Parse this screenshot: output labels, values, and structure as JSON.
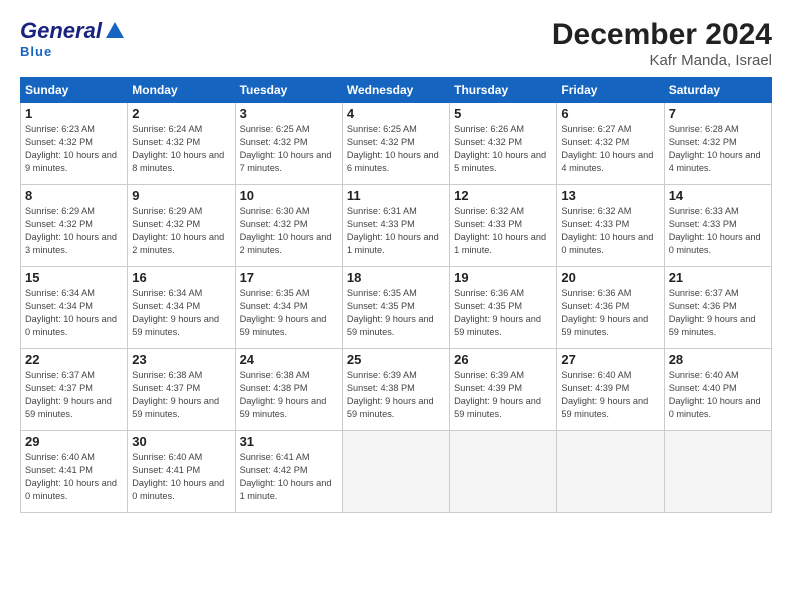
{
  "header": {
    "logo_general": "General",
    "logo_blue": "Blue",
    "month_title": "December 2024",
    "location": "Kafr Manda, Israel"
  },
  "weekdays": [
    "Sunday",
    "Monday",
    "Tuesday",
    "Wednesday",
    "Thursday",
    "Friday",
    "Saturday"
  ],
  "weeks": [
    [
      {
        "day": "1",
        "sunrise": "Sunrise: 6:23 AM",
        "sunset": "Sunset: 4:32 PM",
        "daylight": "Daylight: 10 hours and 9 minutes."
      },
      {
        "day": "2",
        "sunrise": "Sunrise: 6:24 AM",
        "sunset": "Sunset: 4:32 PM",
        "daylight": "Daylight: 10 hours and 8 minutes."
      },
      {
        "day": "3",
        "sunrise": "Sunrise: 6:25 AM",
        "sunset": "Sunset: 4:32 PM",
        "daylight": "Daylight: 10 hours and 7 minutes."
      },
      {
        "day": "4",
        "sunrise": "Sunrise: 6:25 AM",
        "sunset": "Sunset: 4:32 PM",
        "daylight": "Daylight: 10 hours and 6 minutes."
      },
      {
        "day": "5",
        "sunrise": "Sunrise: 6:26 AM",
        "sunset": "Sunset: 4:32 PM",
        "daylight": "Daylight: 10 hours and 5 minutes."
      },
      {
        "day": "6",
        "sunrise": "Sunrise: 6:27 AM",
        "sunset": "Sunset: 4:32 PM",
        "daylight": "Daylight: 10 hours and 4 minutes."
      },
      {
        "day": "7",
        "sunrise": "Sunrise: 6:28 AM",
        "sunset": "Sunset: 4:32 PM",
        "daylight": "Daylight: 10 hours and 4 minutes."
      }
    ],
    [
      {
        "day": "8",
        "sunrise": "Sunrise: 6:29 AM",
        "sunset": "Sunset: 4:32 PM",
        "daylight": "Daylight: 10 hours and 3 minutes."
      },
      {
        "day": "9",
        "sunrise": "Sunrise: 6:29 AM",
        "sunset": "Sunset: 4:32 PM",
        "daylight": "Daylight: 10 hours and 2 minutes."
      },
      {
        "day": "10",
        "sunrise": "Sunrise: 6:30 AM",
        "sunset": "Sunset: 4:32 PM",
        "daylight": "Daylight: 10 hours and 2 minutes."
      },
      {
        "day": "11",
        "sunrise": "Sunrise: 6:31 AM",
        "sunset": "Sunset: 4:33 PM",
        "daylight": "Daylight: 10 hours and 1 minute."
      },
      {
        "day": "12",
        "sunrise": "Sunrise: 6:32 AM",
        "sunset": "Sunset: 4:33 PM",
        "daylight": "Daylight: 10 hours and 1 minute."
      },
      {
        "day": "13",
        "sunrise": "Sunrise: 6:32 AM",
        "sunset": "Sunset: 4:33 PM",
        "daylight": "Daylight: 10 hours and 0 minutes."
      },
      {
        "day": "14",
        "sunrise": "Sunrise: 6:33 AM",
        "sunset": "Sunset: 4:33 PM",
        "daylight": "Daylight: 10 hours and 0 minutes."
      }
    ],
    [
      {
        "day": "15",
        "sunrise": "Sunrise: 6:34 AM",
        "sunset": "Sunset: 4:34 PM",
        "daylight": "Daylight: 10 hours and 0 minutes."
      },
      {
        "day": "16",
        "sunrise": "Sunrise: 6:34 AM",
        "sunset": "Sunset: 4:34 PM",
        "daylight": "Daylight: 9 hours and 59 minutes."
      },
      {
        "day": "17",
        "sunrise": "Sunrise: 6:35 AM",
        "sunset": "Sunset: 4:34 PM",
        "daylight": "Daylight: 9 hours and 59 minutes."
      },
      {
        "day": "18",
        "sunrise": "Sunrise: 6:35 AM",
        "sunset": "Sunset: 4:35 PM",
        "daylight": "Daylight: 9 hours and 59 minutes."
      },
      {
        "day": "19",
        "sunrise": "Sunrise: 6:36 AM",
        "sunset": "Sunset: 4:35 PM",
        "daylight": "Daylight: 9 hours and 59 minutes."
      },
      {
        "day": "20",
        "sunrise": "Sunrise: 6:36 AM",
        "sunset": "Sunset: 4:36 PM",
        "daylight": "Daylight: 9 hours and 59 minutes."
      },
      {
        "day": "21",
        "sunrise": "Sunrise: 6:37 AM",
        "sunset": "Sunset: 4:36 PM",
        "daylight": "Daylight: 9 hours and 59 minutes."
      }
    ],
    [
      {
        "day": "22",
        "sunrise": "Sunrise: 6:37 AM",
        "sunset": "Sunset: 4:37 PM",
        "daylight": "Daylight: 9 hours and 59 minutes."
      },
      {
        "day": "23",
        "sunrise": "Sunrise: 6:38 AM",
        "sunset": "Sunset: 4:37 PM",
        "daylight": "Daylight: 9 hours and 59 minutes."
      },
      {
        "day": "24",
        "sunrise": "Sunrise: 6:38 AM",
        "sunset": "Sunset: 4:38 PM",
        "daylight": "Daylight: 9 hours and 59 minutes."
      },
      {
        "day": "25",
        "sunrise": "Sunrise: 6:39 AM",
        "sunset": "Sunset: 4:38 PM",
        "daylight": "Daylight: 9 hours and 59 minutes."
      },
      {
        "day": "26",
        "sunrise": "Sunrise: 6:39 AM",
        "sunset": "Sunset: 4:39 PM",
        "daylight": "Daylight: 9 hours and 59 minutes."
      },
      {
        "day": "27",
        "sunrise": "Sunrise: 6:40 AM",
        "sunset": "Sunset: 4:39 PM",
        "daylight": "Daylight: 9 hours and 59 minutes."
      },
      {
        "day": "28",
        "sunrise": "Sunrise: 6:40 AM",
        "sunset": "Sunset: 4:40 PM",
        "daylight": "Daylight: 10 hours and 0 minutes."
      }
    ],
    [
      {
        "day": "29",
        "sunrise": "Sunrise: 6:40 AM",
        "sunset": "Sunset: 4:41 PM",
        "daylight": "Daylight: 10 hours and 0 minutes."
      },
      {
        "day": "30",
        "sunrise": "Sunrise: 6:40 AM",
        "sunset": "Sunset: 4:41 PM",
        "daylight": "Daylight: 10 hours and 0 minutes."
      },
      {
        "day": "31",
        "sunrise": "Sunrise: 6:41 AM",
        "sunset": "Sunset: 4:42 PM",
        "daylight": "Daylight: 10 hours and 1 minute."
      },
      null,
      null,
      null,
      null
    ]
  ]
}
